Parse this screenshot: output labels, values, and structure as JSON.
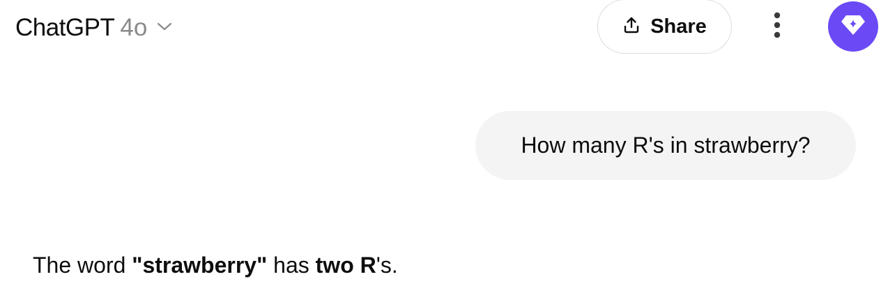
{
  "header": {
    "model_name": "ChatGPT",
    "model_version": "4o",
    "share_label": "Share",
    "icons": {
      "model_dropdown": "chevron-down-icon",
      "share": "share-upload-icon",
      "more": "more-vertical-icon",
      "avatar": "diamond-sparkle-icon"
    },
    "avatar_color": "#6b49f5"
  },
  "conversation": {
    "user_message": "How many R's in strawberry?",
    "assistant_message": {
      "part1": "The word ",
      "part2": "\"strawberry\"",
      "part3": " has ",
      "part4": "two R",
      "part5": "'s."
    }
  }
}
